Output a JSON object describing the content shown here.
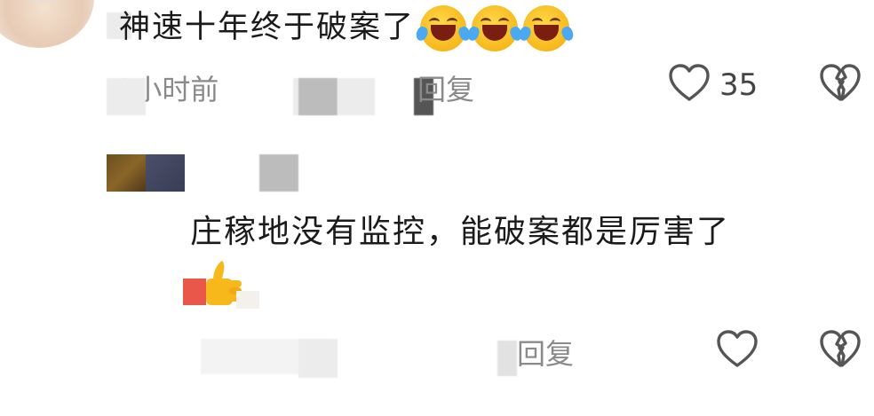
{
  "top_comment": {
    "text": "神速十年终于破案了",
    "emojis": [
      "laughing-crying-emoji",
      "laughing-crying-emoji",
      "laughing-crying-emoji"
    ],
    "time_label": "1小时前",
    "reply_label": "回复",
    "like_count": "35"
  },
  "reply_comment": {
    "text": "庄稼地没有监控，能破案都是厉害了",
    "emoji": "thumbs-up-emoji",
    "reply_label": "回复"
  },
  "icons": {
    "like": "heart-outline-icon",
    "dislike": "broken-heart-icon"
  },
  "colors": {
    "text": "#1b1b1b",
    "meta": "#8a8a8a",
    "icon": "#555555",
    "emoji_yellow": "#f7b81c"
  }
}
